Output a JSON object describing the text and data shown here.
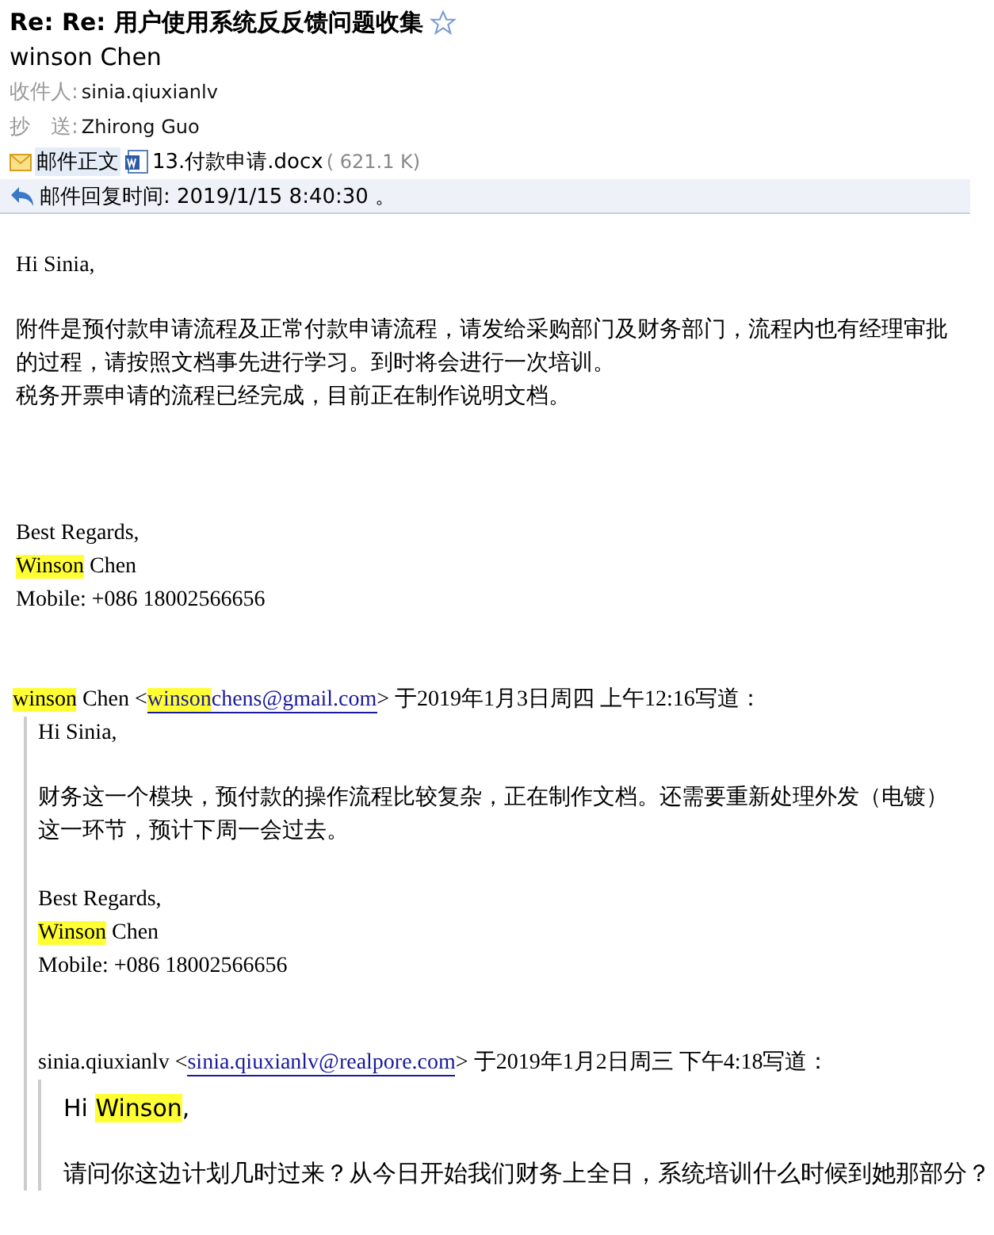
{
  "header": {
    "subject": "Re: Re: 用户使用系统反反馈问题收集",
    "starred": false,
    "sender": "winson Chen",
    "to_label": "收件人:",
    "to": "sinia.qiuxianlv",
    "cc_label": "抄　送:",
    "cc": "Zhirong Guo",
    "body_tab": "邮件正文",
    "attachment": "13.付款申请.docx",
    "attachment_size": "( 621.1 K)",
    "reply_time": "邮件回复时间: 2019/1/15 8:40:30 。"
  },
  "message": {
    "greeting": [
      {
        "text": "Hi Sinia,",
        "highlighted": false
      }
    ],
    "lines": [
      "附件是预付款申请流程及正常付款申请流程，请发给采购部门及财务部门，流程内也有经理审批",
      "的过程，请按照文档事先进行学习。到时将会进行一次培训。",
      "税务开票申请的流程已经完成，目前正在制作说明文档。"
    ],
    "closing": "Best Regards,",
    "name": [
      {
        "text": "Winson",
        "highlighted": true
      },
      {
        "text": " Chen",
        "highlighted": false
      }
    ],
    "mobile": "Mobile: +086 18002566656",
    "quote": {
      "attribution": [
        {
          "text": "winson",
          "highlighted": true,
          "kind": "text"
        },
        {
          "text": " Chen <",
          "highlighted": false,
          "kind": "text"
        },
        {
          "text": "winson",
          "highlighted": true,
          "kind": "link"
        },
        {
          "text": "chens@gmail.com",
          "highlighted": false,
          "kind": "link"
        },
        {
          "text": "> 于2019年1月3日周四  上午12:16写道：",
          "highlighted": false,
          "kind": "text"
        }
      ],
      "message": {
        "greeting": [
          {
            "text": "Hi Sinia,",
            "highlighted": false
          }
        ],
        "lines": [
          "财务这一个模块，预付款的操作流程比较复杂，正在制作文档。还需要重新处理外发（电镀）",
          "这一环节，预计下周一会过去。"
        ],
        "closing": "Best Regards,",
        "name": [
          {
            "text": "Winson",
            "highlighted": true
          },
          {
            "text": " Chen",
            "highlighted": false
          }
        ],
        "mobile": "Mobile: +086 18002566656",
        "quote": {
          "attribution": [
            {
              "text": "sinia.qiuxianlv <",
              "highlighted": false,
              "kind": "text"
            },
            {
              "text": "sinia.qiuxianlv@realpore.com",
              "highlighted": false,
              "kind": "link"
            },
            {
              "text": "> 于2019年1月2日周三  下午4:18写道：",
              "highlighted": false,
              "kind": "text"
            }
          ],
          "message": {
            "greeting": [
              {
                "text": "Hi ",
                "highlighted": false
              },
              {
                "text": "Winson",
                "highlighted": true
              },
              {
                "text": ",",
                "highlighted": false
              }
            ],
            "lines": [
              "请问你这边计划几时过来？从今日开始我们财务上全日，系统培训什么时候到她那部分？"
            ]
          }
        }
      }
    }
  }
}
